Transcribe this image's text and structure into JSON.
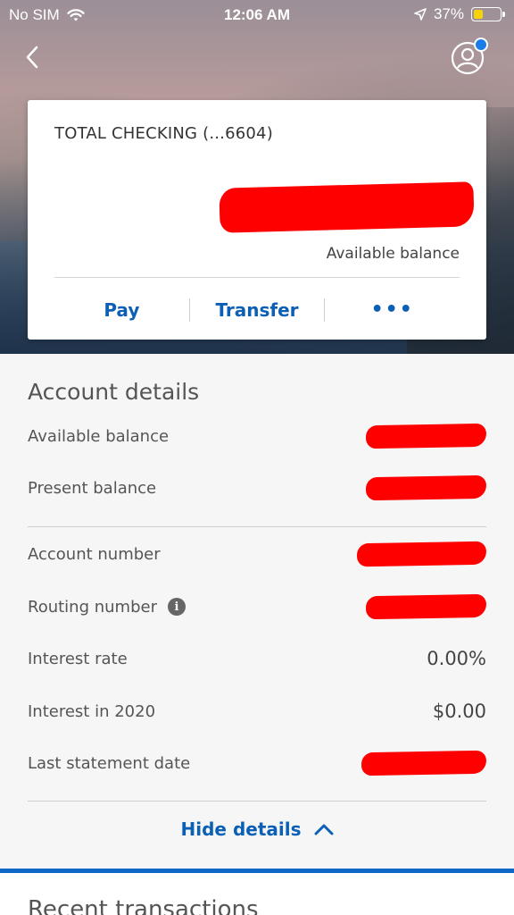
{
  "status_bar": {
    "carrier": "No SIM",
    "time": "12:06 AM",
    "battery_percent": "37%",
    "battery_level": 0.37,
    "battery_color": "#f5d20b",
    "icons": [
      "wifi-icon",
      "location-arrow-icon",
      "battery-icon"
    ]
  },
  "nav": {
    "back_icon": "chevron-left-icon",
    "profile_icon": "profile-icon",
    "notification_dot_color": "#1a7ce8"
  },
  "account_card": {
    "account_name": "TOTAL CHECKING (...6604)",
    "balance_label": "Available balance",
    "actions": {
      "pay": "Pay",
      "transfer": "Transfer",
      "more": "•••"
    }
  },
  "details": {
    "title": "Account details",
    "rows": {
      "available_balance": {
        "label": "Available balance",
        "value": ""
      },
      "present_balance": {
        "label": "Present balance",
        "value": ""
      },
      "account_number": {
        "label": "Account number",
        "value": ""
      },
      "routing_number": {
        "label": "Routing number",
        "value": ""
      },
      "interest_rate": {
        "label": "Interest rate",
        "value": "0.00%"
      },
      "interest_year": {
        "label": "Interest in 2020",
        "value": "$0.00"
      },
      "last_statement": {
        "label": "Last statement date",
        "value": ""
      }
    },
    "hide_label": "Hide details"
  },
  "recent": {
    "title": "Recent transactions"
  },
  "colors": {
    "accent": "#0b5fb5",
    "redaction": "#ff0000",
    "divider_bar": "#1167c6"
  }
}
